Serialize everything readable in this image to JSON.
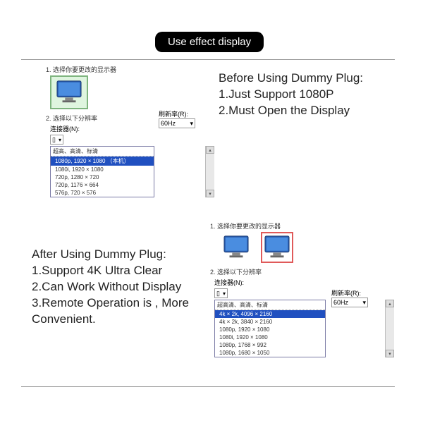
{
  "header": {
    "title": "Use effect display"
  },
  "before": {
    "heading": "Before Using Dummy Plug:",
    "line1": "1.Just Support 1080P",
    "line2": "2.Must Open the Display",
    "step1": "1. 选择你要更改的显示器",
    "step2": "2. 选择以下分辨率",
    "connectorLabel": "连接器(N):",
    "connectorValue": "▯",
    "refreshLabel": "刷新率(R):",
    "refreshValue": "60Hz",
    "listHeader": "超高、高清、标清",
    "resSelected": "1080p, 1920 × 1080 （本机）",
    "res1": "1080i, 1920 × 1080",
    "res2": "720p, 1280 × 720",
    "res3": "720p, 1176 × 664",
    "res4": "576p, 720 × 576"
  },
  "after": {
    "heading": "After Using Dummy Plug:",
    "line1": "1.Support 4K Ultra Clear",
    "line2": "2.Can Work Without Display",
    "line3": "3.Remote Operation is   , More Convenient.",
    "step1": "1. 选择你要更改的显示器",
    "step2": "2. 选择以下分辨率",
    "connectorLabel": "连接器(N):",
    "connectorValue": "▯",
    "refreshLabel": "刷新率(R):",
    "refreshValue": "60Hz",
    "listHeader": "超高清、高清、标清",
    "resSelected": "4k × 2k, 4096 × 2160",
    "res1": "4k × 2k, 3840 × 2160",
    "res2": "1080p, 1920 × 1080",
    "res3": "1080i, 1920 × 1080",
    "res4": "1080p, 1768 × 992",
    "res5": "1080p, 1680 × 1050"
  }
}
